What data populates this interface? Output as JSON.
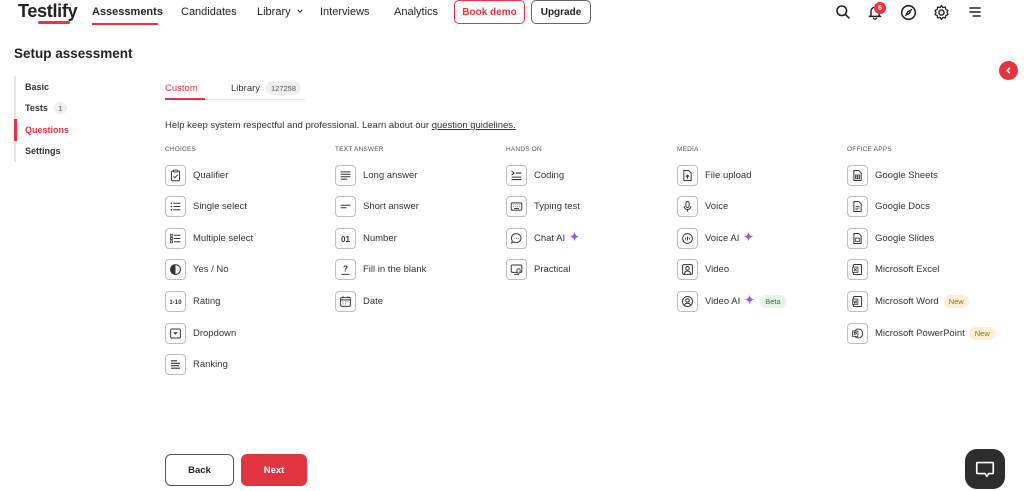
{
  "brand": {
    "logo": "Testlify",
    "accent": "#e8323f"
  },
  "nav": {
    "items": [
      {
        "label": "Assessments",
        "active": true
      },
      {
        "label": "Candidates"
      },
      {
        "label": "Library"
      },
      {
        "label": "Interviews"
      },
      {
        "label": "Analytics"
      }
    ],
    "book_demo": "Book demo",
    "upgrade": "Upgrade",
    "notification_count": "6",
    "icons": [
      "search-icon",
      "bell-icon",
      "compass-icon",
      "gear-icon",
      "menu-icon"
    ]
  },
  "page": {
    "title": "Setup assessment"
  },
  "steps": [
    {
      "label": "Basic"
    },
    {
      "label": "Tests",
      "count": "1"
    },
    {
      "label": "Questions",
      "active": true
    },
    {
      "label": "Settings"
    }
  ],
  "tabs": {
    "custom": "Custom",
    "library": "Library",
    "library_count": "127258"
  },
  "help": {
    "text": "Help keep system respectful and professional. Learn about our ",
    "link": "question guidelines."
  },
  "columns": [
    {
      "title": "CHOICES",
      "items": [
        {
          "label": "Qualifier",
          "icon": "clipboard-icon"
        },
        {
          "label": "Single select",
          "icon": "list-icon"
        },
        {
          "label": "Multiple select",
          "icon": "checklist-icon"
        },
        {
          "label": "Yes / No",
          "icon": "half-circle-icon"
        },
        {
          "label": "Rating",
          "icon": "rating-icon"
        },
        {
          "label": "Dropdown",
          "icon": "dropdown-icon"
        },
        {
          "label": "Ranking",
          "icon": "ranking-icon"
        }
      ]
    },
    {
      "title": "TEXT ANSWER",
      "items": [
        {
          "label": "Long answer",
          "icon": "long-text-icon"
        },
        {
          "label": "Short answer",
          "icon": "short-text-icon"
        },
        {
          "label": "Number",
          "icon": "number-icon"
        },
        {
          "label": "Fill in the blank",
          "icon": "question-icon"
        },
        {
          "label": "Date",
          "icon": "calendar-icon"
        }
      ]
    },
    {
      "title": "HANDS ON",
      "items": [
        {
          "label": "Coding",
          "icon": "code-icon"
        },
        {
          "label": "Typing test",
          "icon": "keyboard-icon"
        },
        {
          "label": "Chat AI",
          "icon": "chat-icon",
          "ai": true
        },
        {
          "label": "Practical",
          "icon": "practical-icon"
        }
      ]
    },
    {
      "title": "MEDIA",
      "items": [
        {
          "label": "File upload",
          "icon": "file-upload-icon"
        },
        {
          "label": "Voice",
          "icon": "microphone-icon"
        },
        {
          "label": "Voice AI",
          "icon": "voice-ai-icon",
          "ai": true
        },
        {
          "label": "Video",
          "icon": "video-icon"
        },
        {
          "label": "Video AI",
          "icon": "video-ai-icon",
          "ai": true,
          "tag": "Beta"
        }
      ]
    },
    {
      "title": "OFFICE APPS",
      "items": [
        {
          "label": "Google Sheets",
          "icon": "sheets-icon"
        },
        {
          "label": "Google Docs",
          "icon": "docs-icon"
        },
        {
          "label": "Google Slides",
          "icon": "slides-icon"
        },
        {
          "label": "Microsoft Excel",
          "icon": "excel-icon"
        },
        {
          "label": "Microsoft Word",
          "icon": "word-icon",
          "tag": "New"
        },
        {
          "label": "Microsoft PowerPoint",
          "icon": "powerpoint-icon",
          "tag": "New"
        }
      ]
    }
  ],
  "footer": {
    "back": "Back",
    "next": "Next"
  }
}
